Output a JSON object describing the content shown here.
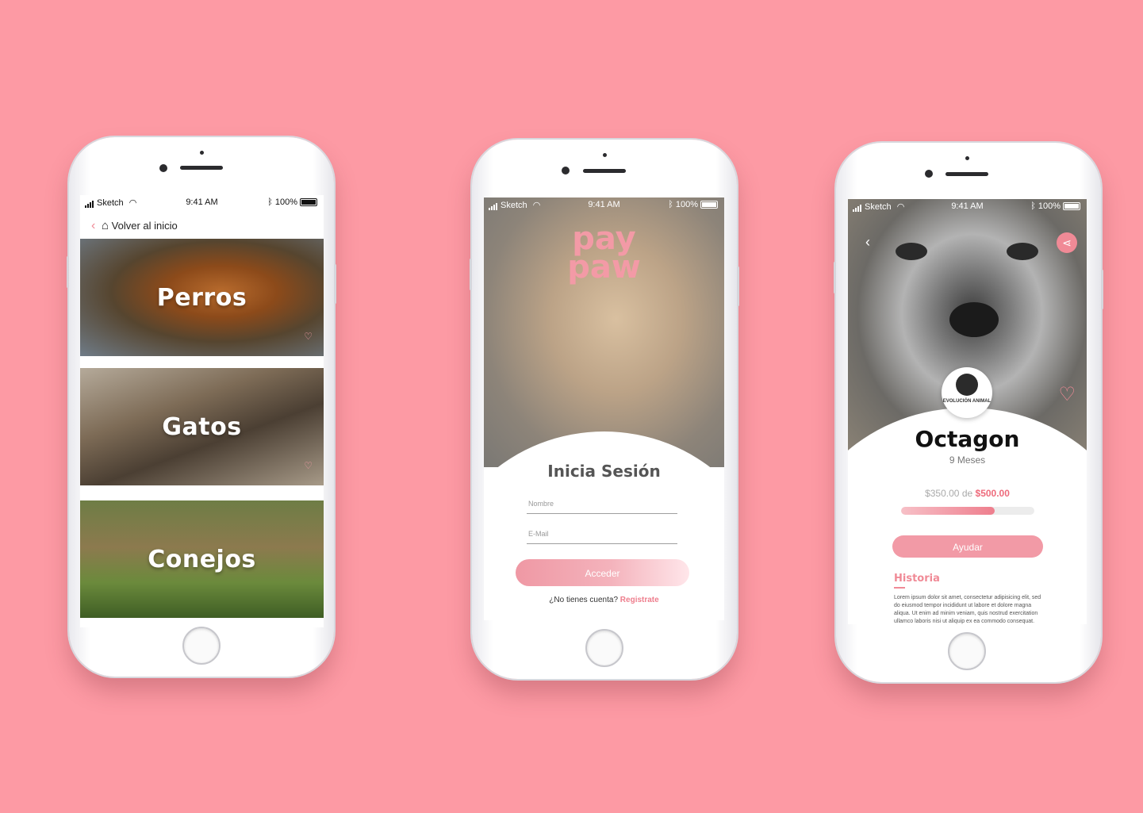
{
  "statusbar": {
    "carrier": "Sketch",
    "time": "9:41 AM",
    "battery": "100%"
  },
  "categories_screen": {
    "back_label": "Volver al inicio",
    "cards": [
      {
        "title": "Perros"
      },
      {
        "title": "Gatos"
      },
      {
        "title": "Conejos"
      }
    ]
  },
  "login_screen": {
    "logo_top": "pay",
    "logo_bottom": "paw",
    "title": "Inicia Sesión",
    "name_placeholder": "Nombre",
    "email_placeholder": "E-Mail",
    "submit_label": "Acceder",
    "no_account_text": "¿No tienes cuenta?",
    "register_link": "Registrate"
  },
  "detail_screen": {
    "org_name": "EVOLUCIÓN ANIMAL",
    "pet_name": "Octagon",
    "pet_age": "9 Meses",
    "raised_amount": "$350.00",
    "raised_connector": "de",
    "goal_amount": "$500.00",
    "progress_fraction": 0.7,
    "help_label": "Ayudar",
    "history_title": "Historia",
    "history_text": "Lorem ipsum dolor sit amet, consectetur adipisicing elit, sed do eiusmod tempor incididunt ut labore et dolore magna aliqua. Ut enim ad minim veniam, quis nostrud exercitation ullamco laboris nisi ut aliquip ex ea commodo consequat."
  },
  "colors": {
    "background": "#fd9aa4",
    "accent": "#f08a96"
  }
}
